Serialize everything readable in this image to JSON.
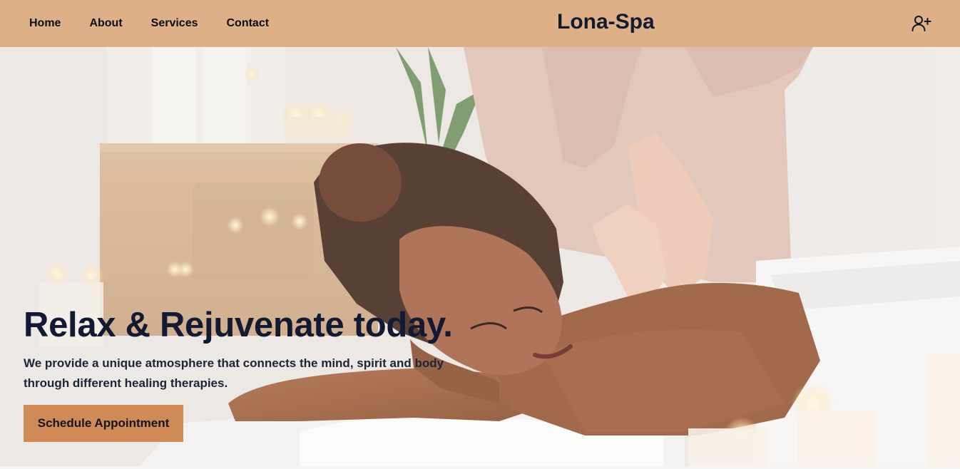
{
  "nav": {
    "links": [
      "Home",
      "About",
      "Services",
      "Contact"
    ],
    "brand": "Lona-Spa",
    "user_icon": "user-plus-icon",
    "bg_color": "#deb088"
  },
  "hero": {
    "title": "Relax & Rejuvenate today.",
    "subtitle": "We provide a unique atmosphere that connects the mind, spirit and body through different healing therapies.",
    "cta_label": "Schedule Appointment",
    "cta_color": "#cf8a56"
  }
}
